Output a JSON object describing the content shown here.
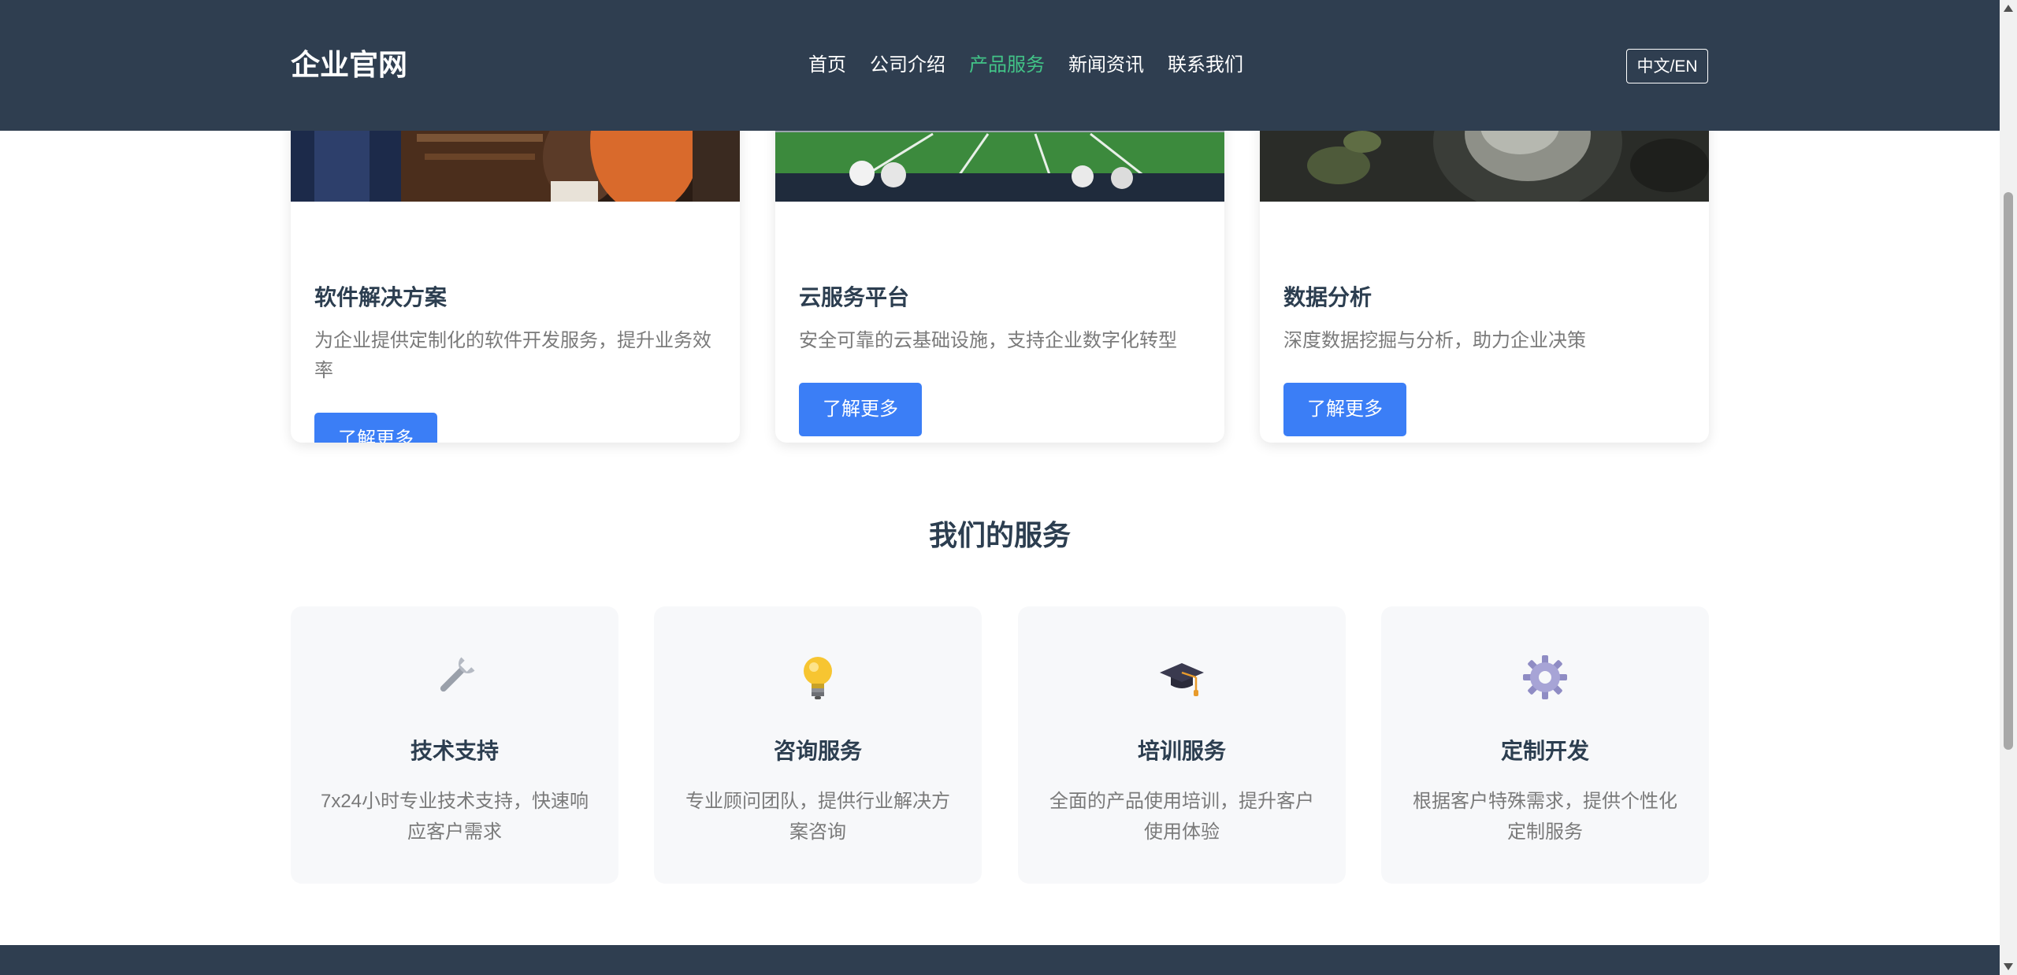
{
  "header": {
    "brand": "企业官网",
    "nav": [
      {
        "label": "首页",
        "active": false
      },
      {
        "label": "公司介绍",
        "active": false
      },
      {
        "label": "产品服务",
        "active": true
      },
      {
        "label": "新闻资讯",
        "active": false
      },
      {
        "label": "联系我们",
        "active": false
      }
    ],
    "lang_toggle": "中文/EN"
  },
  "products": [
    {
      "title": "软件解决方案",
      "desc": "为企业提供定制化的软件开发服务，提升业务效率",
      "button": "了解更多"
    },
    {
      "title": "云服务平台",
      "desc": "安全可靠的云基础设施，支持企业数字化转型",
      "button": "了解更多"
    },
    {
      "title": "数据分析",
      "desc": "深度数据挖掘与分析，助力企业决策",
      "button": "了解更多"
    }
  ],
  "services": {
    "title": "我们的服务",
    "items": [
      {
        "icon": "wrench-icon",
        "title": "技术支持",
        "desc": "7x24小时专业技术支持，快速响应客户需求"
      },
      {
        "icon": "lightbulb-icon",
        "title": "咨询服务",
        "desc": "专业顾问团队，提供行业解决方案咨询"
      },
      {
        "icon": "graduation-cap-icon",
        "title": "培训服务",
        "desc": "全面的产品使用培训，提升客户使用体验"
      },
      {
        "icon": "gear-icon",
        "title": "定制开发",
        "desc": "根据客户特殊需求，提供个性化定制服务"
      }
    ]
  },
  "colors": {
    "header_bg": "#2f3e50",
    "nav_active": "#42c387",
    "primary_button": "#3b7ef6",
    "heading_text": "#2c3e50",
    "body_text": "#7a7a7a",
    "service_card_bg": "#f7f8fa"
  }
}
